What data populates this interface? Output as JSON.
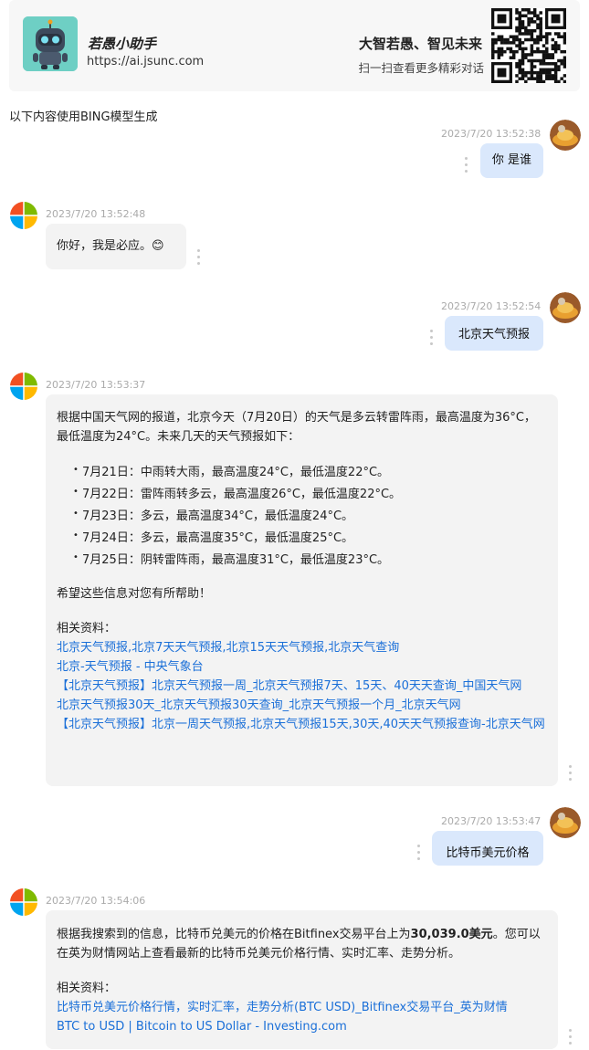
{
  "header": {
    "brand_name": "若愚小助手",
    "brand_url": "https://ai.jsunc.com",
    "slogan": "大智若愚、智见未来",
    "scan_tip": "扫一扫查看更多精彩对话",
    "logo_icon": "robot-mascot-icon",
    "qr_icon": "qr-code-icon"
  },
  "model_note": "以下内容使用BING模型生成",
  "messages": [
    {
      "role": "user",
      "timestamp": "2023/7/20 13:52:38",
      "text": "你 是谁"
    },
    {
      "role": "bot",
      "timestamp": "2023/7/20 13:52:48",
      "text": "你好，我是必应。😊"
    },
    {
      "role": "user",
      "timestamp": "2023/7/20 13:52:54",
      "text": "北京天气预报"
    },
    {
      "role": "bot",
      "timestamp": "2023/7/20 13:53:37",
      "intro": "根据中国天气网的报道，北京今天（7月20日）的天气是多云转雷阵雨，最高温度为36°C，最低温度为24°C。未来几天的天气预报如下：",
      "forecast": [
        "7月21日：中雨转大雨，最高温度24°C，最低温度22°C。",
        "7月22日：雷阵雨转多云，最高温度26°C，最低温度22°C。",
        "7月23日：多云，最高温度34°C，最低温度24°C。",
        "7月24日：多云，最高温度35°C，最低温度25°C。",
        "7月25日：阴转雷阵雨，最高温度31°C，最低温度23°C。"
      ],
      "outro": "希望这些信息对您有所帮助！",
      "refs_label": "相关资料：",
      "refs": [
        "北京天气预报,北京7天天气预报,北京15天天气预报,北京天气查询",
        "北京-天气预报 - 中央气象台",
        "【北京天气预报】北京天气预报一周_北京天气预报7天、15天、40天天查询_中国天气网",
        "北京天气预报30天_北京天气预报30天查询_北京天气预报一个月_北京天气网",
        "【北京天气预报】北京一周天气预报,北京天气预报15天,30天,40天天气预报查询-北京天气网"
      ]
    },
    {
      "role": "user",
      "timestamp": "2023/7/20 13:53:47",
      "text": "比特币美元价格"
    },
    {
      "role": "bot",
      "timestamp": "2023/7/20 13:54:06",
      "intro_before": "根据我搜索到的信息，比特币兑美元的价格在Bitfinex交易平台上为",
      "intro_bold": "30,039.0美元",
      "intro_after": "。您可以在英为财情网站上查看最新的比特币兑美元价格行情、实时汇率、走势分析。",
      "refs_label": "相关资料：",
      "refs": [
        "比特币兑美元价格行情，实时汇率，走势分析(BTC USD)_Bitfinex交易平台_英为财情",
        "BTC to USD | Bitcoin to US Dollar - Investing.com"
      ]
    }
  ],
  "colors": {
    "user_bubble": "#dae8fc",
    "bot_bubble": "#f3f3f3",
    "link": "#1a6fd8",
    "timestamp": "#aaaaaa"
  }
}
